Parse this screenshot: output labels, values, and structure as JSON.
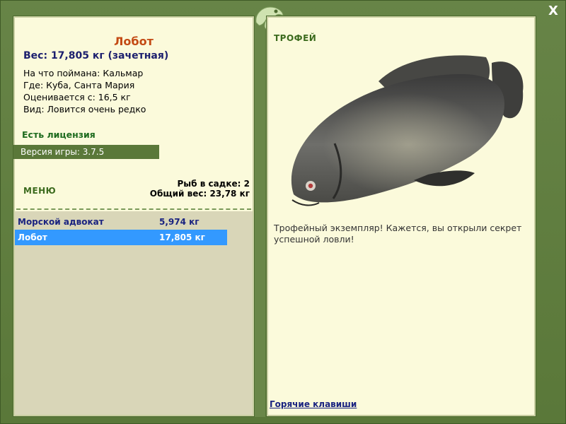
{
  "window": {
    "close_label": "X"
  },
  "fish": {
    "title": "Лобот",
    "weight_line": "Вес: 17,805 кг (зачетная)",
    "details": [
      "На что поймана: Кальмар",
      "Где: Куба, Санта Мария",
      "Оценивается с: 16,5 кг",
      "Вид: Ловится очень редко"
    ]
  },
  "license": "Есть лицензия",
  "version": "Версия игры: 3.7.5",
  "menu_label": "МЕНЮ",
  "keepnet": {
    "count_line": "Рыб в садке: 2",
    "total_line": "Общий вес: 23,78 кг"
  },
  "catch_list": [
    {
      "name": "Морской адвокат",
      "weight": "5,974 кг"
    },
    {
      "name": "Лобот",
      "weight": "17,805 кг"
    }
  ],
  "trophy": {
    "label": "ТРОФЕЙ",
    "caption": "Трофейный экземпляр! Кажется, вы открыли секрет успешной ловли!"
  },
  "hotkeys_label": "Горячие клавиши",
  "colors": {
    "frame": "#5e7a3e",
    "panel": "#fbfadb",
    "title": "#c34a14",
    "selected_row": "#3399ff"
  },
  "icons": [
    "chameleon-logo-icon",
    "close-icon"
  ]
}
